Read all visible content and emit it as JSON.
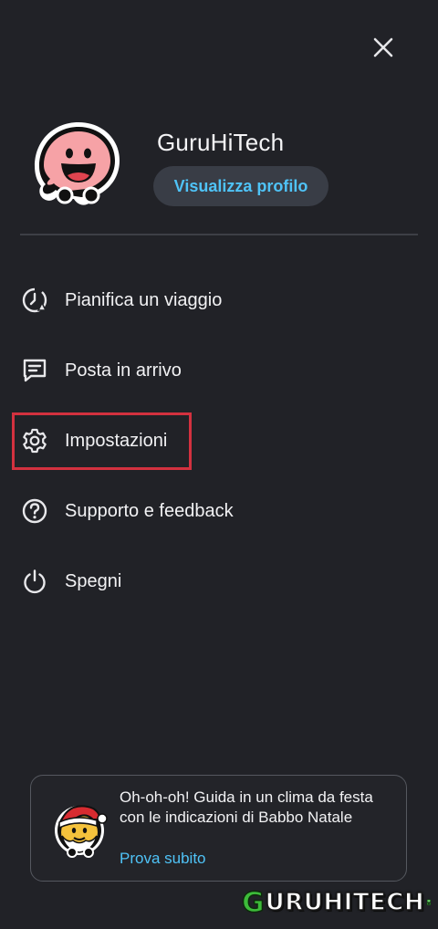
{
  "header": {
    "close_icon": "close-icon"
  },
  "profile": {
    "username": "GuruHiTech",
    "view_profile_label": "Visualizza profilo",
    "avatar_icon": "waze-smiley-icon"
  },
  "menu": {
    "items": [
      {
        "label": "Pianifica un viaggio",
        "icon": "plan-drive-clock-icon"
      },
      {
        "label": "Posta in arrivo",
        "icon": "inbox-message-icon"
      },
      {
        "label": "Impostazioni",
        "icon": "gear-icon"
      },
      {
        "label": "Supporto e feedback",
        "icon": "help-question-icon"
      },
      {
        "label": "Spegni",
        "icon": "power-icon"
      }
    ],
    "highlighted_item": "Impostazioni"
  },
  "promo": {
    "text": "Oh-oh-oh! Guida in un clima da festa con le indicazioni di Babbo Natale",
    "link_label": "Prova subito",
    "icon": "santa-waze-icon"
  },
  "watermark": {
    "first_letter": "G",
    "rest": "URUHITECH"
  },
  "colors": {
    "background": "#212227",
    "accent_link": "#4fc3f7",
    "button_bg": "#393d46",
    "highlight_border": "#d3313f",
    "text": "#f2f2f4"
  }
}
